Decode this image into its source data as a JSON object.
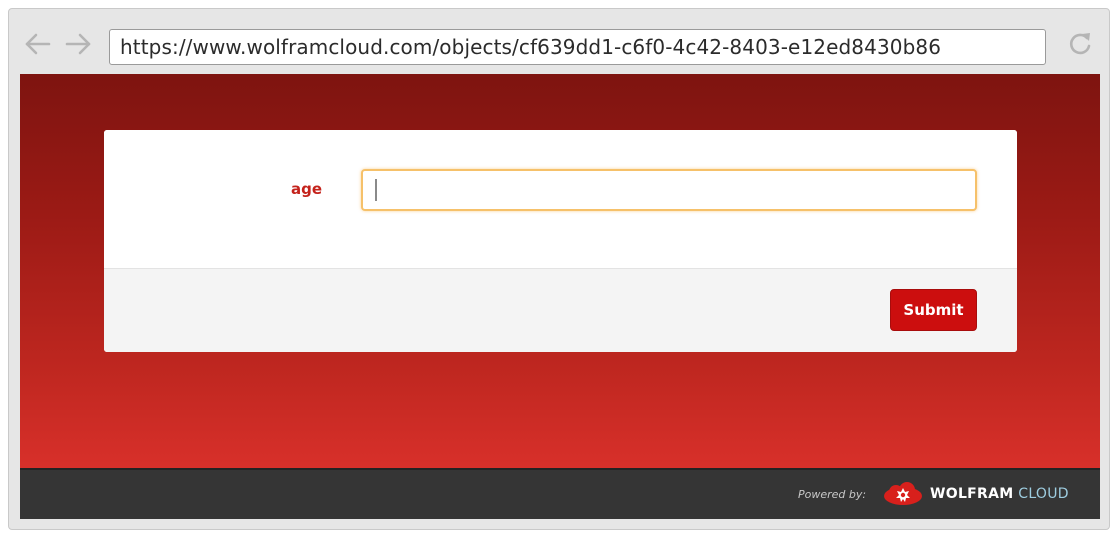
{
  "browser": {
    "url": "https://www.wolframcloud.com/objects/cf639dd1-c6f0-4c42-8403-e12ed8430b86",
    "back_icon": "arrow-left-icon",
    "forward_icon": "arrow-right-icon",
    "reload_icon": "reload-icon"
  },
  "form": {
    "field_label": "age",
    "field_value": "",
    "submit_label": "Submit"
  },
  "footer": {
    "powered_by": "Powered by:",
    "brand_main": "WOLFRAM",
    "brand_sub": "CLOUD",
    "logo_icon": "wolfram-spikey-cloud-icon"
  },
  "colors": {
    "accent": "#cc0e0e",
    "label": "#c4221b",
    "focus_ring": "#f6c16a",
    "footer_bg": "#353535",
    "brand_sub": "#9ecde0"
  }
}
